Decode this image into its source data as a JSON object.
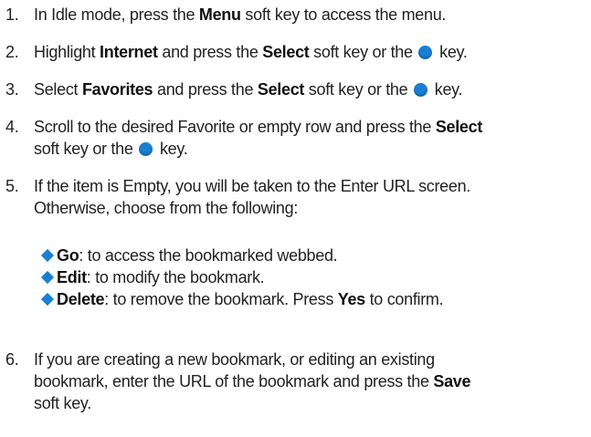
{
  "steps": [
    {
      "num": "1.",
      "t1": "In Idle mode, press the ",
      "b1": "Menu",
      "t2": " soft key to access the menu."
    },
    {
      "num": "2.",
      "t1": "Highlight ",
      "b1": "Internet",
      "t2": " and press the ",
      "b2": "Select",
      "t3": " soft key or the ",
      "t4": " key."
    },
    {
      "num": "3.",
      "t1": "Select ",
      "b1": "Favorites",
      "t2": " and press the ",
      "b2": "Select",
      "t3": " soft key or the ",
      "t4": " key."
    },
    {
      "num": "4.",
      "t1": "Scroll to the desired Favorite or empty row and press the ",
      "b1": "Select",
      "t2": "soft key or the ",
      "t3": " key."
    },
    {
      "num": "5.",
      "line1": "If the item is Empty, you will be taken to the Enter URL screen.",
      "line2": "Otherwise, choose from the following:"
    },
    {
      "num": "6.",
      "line1": "If you are creating a new bookmark, or editing an existing",
      "t1": "bookmark, enter the URL of the bookmark and press the ",
      "b1": "Save",
      "line3": "soft key."
    }
  ],
  "options": [
    {
      "label": "Go",
      "text": ": to access the bookmarked webbed."
    },
    {
      "label": "Edit",
      "text": ": to modify the bookmark."
    },
    {
      "label": "Delete",
      "text": ": to remove the bookmark. Press ",
      "label2": "Yes",
      "text2": " to confirm."
    }
  ],
  "icons": {
    "ok_key": "ok-key-icon",
    "bullet": "diamond-bullet-icon"
  },
  "colors": {
    "accent": "#1a7fd4",
    "text": "#222222"
  }
}
